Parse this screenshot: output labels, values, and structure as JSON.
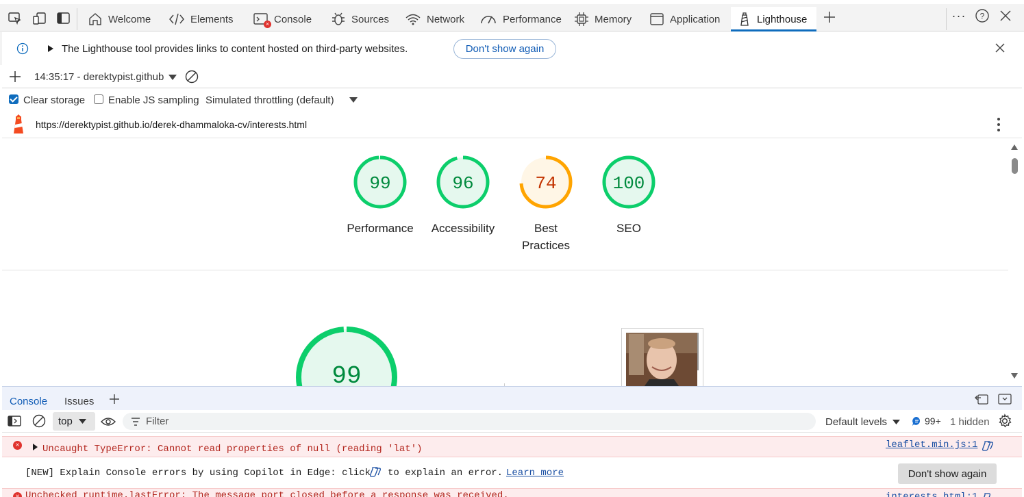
{
  "tabs": [
    {
      "label": "Welcome",
      "icon": "home-icon"
    },
    {
      "label": "Elements",
      "icon": "code-icon"
    },
    {
      "label": "Console",
      "icon": "console-icon"
    },
    {
      "label": "Sources",
      "icon": "bug-icon"
    },
    {
      "label": "Network",
      "icon": "wifi-icon"
    },
    {
      "label": "Performance",
      "icon": "gauge-icon"
    },
    {
      "label": "Memory",
      "icon": "chip-icon"
    },
    {
      "label": "Application",
      "icon": "window-icon"
    },
    {
      "label": "Lighthouse",
      "icon": "lighthouse-icon",
      "active": true
    }
  ],
  "infobar": {
    "text": "The Lighthouse tool provides links to content hosted on third-party websites.",
    "button": "Don't show again"
  },
  "lh_toolbar": {
    "report_select": "14:35:17 - derektypist.github"
  },
  "lh_settings": {
    "clear_storage": "Clear storage",
    "js_sampling": "Enable JS sampling",
    "throttling": "Simulated throttling (default)"
  },
  "lh_url": "https://derektypist.github.io/derek-dhammaloka-cv/interests.html",
  "scores": [
    {
      "value": "99",
      "label": "Performance",
      "score": 0.99,
      "color": "#0cce6b"
    },
    {
      "value": "96",
      "label": "Accessibility",
      "score": 0.96,
      "color": "#0cce6b"
    },
    {
      "value": "74",
      "label": "Best Practices",
      "score": 0.74,
      "color": "#ffa400"
    },
    {
      "value": "100",
      "label": "SEO",
      "score": 1.0,
      "color": "#0cce6b"
    }
  ],
  "big_score": {
    "value": "99",
    "score": 0.99
  },
  "drawer": {
    "tabs": [
      "Console",
      "Issues"
    ],
    "context": "top",
    "filter_placeholder": "Filter",
    "levels": "Default levels",
    "issues_count": "99+",
    "hidden": "1 hidden"
  },
  "messages": {
    "error1": {
      "text": "Uncaught TypeError: Cannot read properties of null (reading 'lat')",
      "source": "leaflet.min.js:1"
    },
    "copilot": {
      "text_before": "[NEW] Explain Console errors by using Copilot in Edge: click",
      "text_after": "to explain an error.",
      "link": "Learn more",
      "button": "Don't show again"
    },
    "error2": {
      "text": "Unchecked runtime.lastError: The message port closed before a response was received.",
      "source": "interests.html:1"
    }
  },
  "colors": {
    "accent": "#0f6cbd",
    "pass": "#0cce6b",
    "average": "#ffa400"
  }
}
